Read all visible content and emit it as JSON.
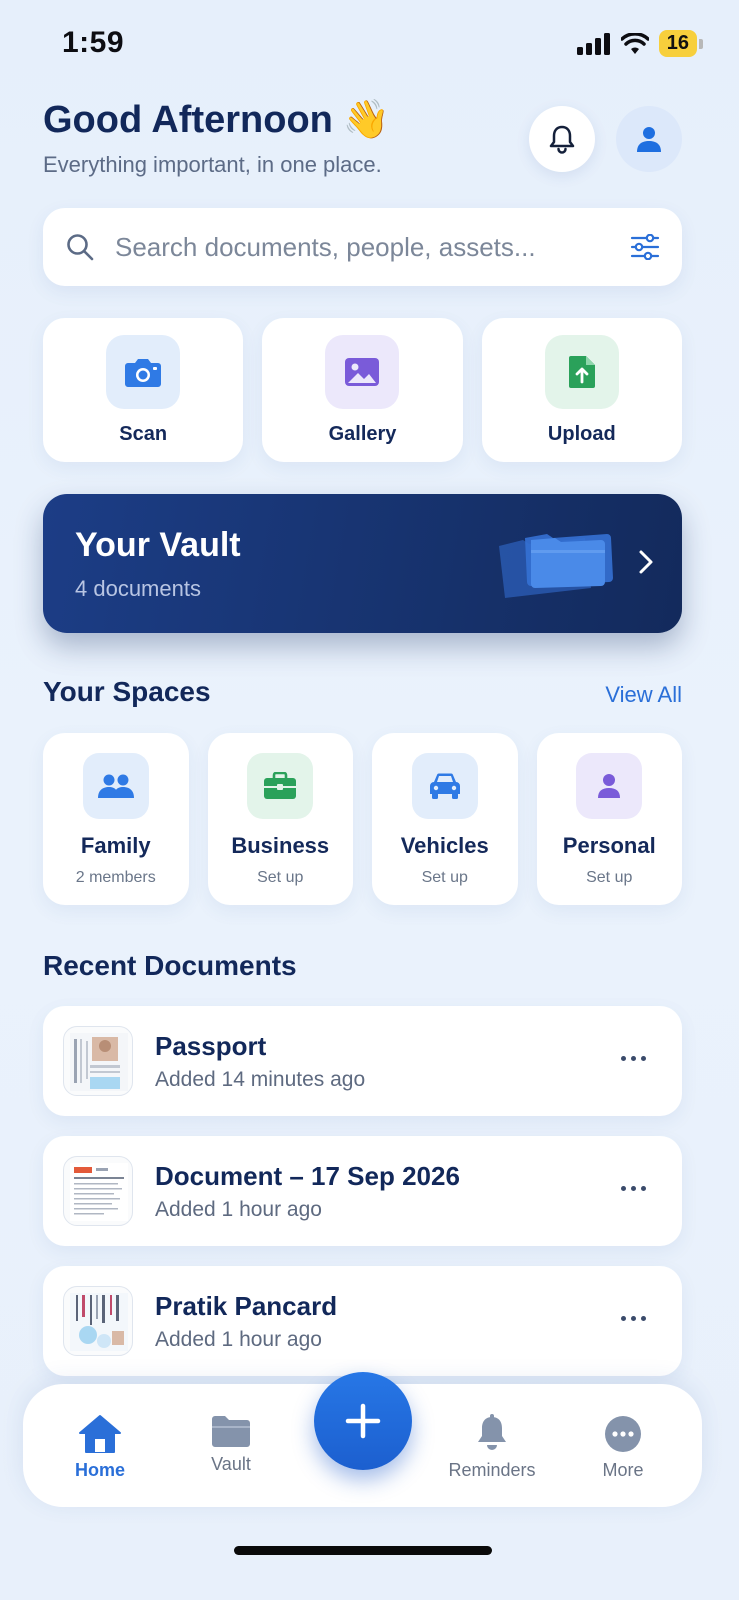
{
  "status_bar": {
    "time": "1:59",
    "battery": "16"
  },
  "header": {
    "greeting": "Good Afternoon",
    "emoji": "👋",
    "subtitle": "Everything important, in one place."
  },
  "search": {
    "placeholder": "Search documents, people, assets..."
  },
  "quick_actions": [
    {
      "label": "Scan",
      "icon": "camera-icon",
      "bg": "#e2edfb",
      "color": "#2f7ae5"
    },
    {
      "label": "Gallery",
      "icon": "image-icon",
      "bg": "#ece8fb",
      "color": "#7a5bd9"
    },
    {
      "label": "Upload",
      "icon": "file-upload-icon",
      "bg": "#e3f4ea",
      "color": "#2aa15a"
    }
  ],
  "vault": {
    "title": "Your Vault",
    "subtitle": "4 documents"
  },
  "spaces": {
    "title": "Your Spaces",
    "view_all": "View All",
    "items": [
      {
        "name": "Family",
        "sub": "2 members",
        "icon": "people-icon",
        "bg": "#e2edfb",
        "color": "#2f7ae5"
      },
      {
        "name": "Business",
        "sub": "Set up",
        "icon": "briefcase-icon",
        "bg": "#e3f4ea",
        "color": "#2aa15a"
      },
      {
        "name": "Vehicles",
        "sub": "Set up",
        "icon": "car-icon",
        "bg": "#e2edfb",
        "color": "#2f7ae5"
      },
      {
        "name": "Personal",
        "sub": "Set up",
        "icon": "person-icon",
        "bg": "#ece8fb",
        "color": "#7a5bd9"
      }
    ]
  },
  "recent": {
    "title": "Recent Documents",
    "items": [
      {
        "title": "Passport",
        "meta": "Added 14 minutes ago"
      },
      {
        "title": "Document – 17 Sep 2026",
        "meta": "Added 1 hour ago"
      },
      {
        "title": "Pratik Pancard",
        "meta": "Added 1 hour ago"
      }
    ]
  },
  "tabbar": {
    "home": "Home",
    "vault": "Vault",
    "reminders": "Reminders",
    "more": "More"
  },
  "colors": {
    "accent": "#2a6fd8",
    "navy": "#12285a",
    "vault_bg": "#1c3d86"
  }
}
